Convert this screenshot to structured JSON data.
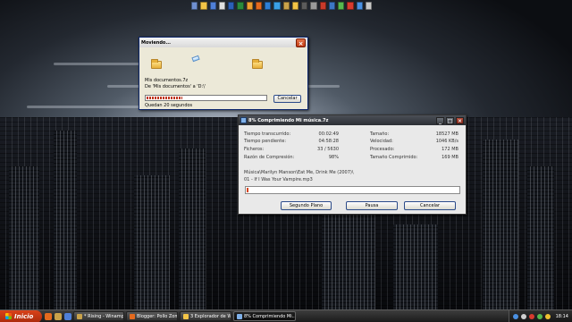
{
  "top_toolbar": {
    "icons": [
      {
        "name": "show-desktop-icon",
        "color": "#6f8fd0"
      },
      {
        "name": "folder-icon",
        "color": "#f2c447"
      },
      {
        "name": "explorer-icon",
        "color": "#4f7fd8"
      },
      {
        "name": "email-icon",
        "color": "#e0e0e0"
      },
      {
        "name": "word-icon",
        "color": "#2b5fb8"
      },
      {
        "name": "excel-icon",
        "color": "#2a8a3c"
      },
      {
        "name": "media-icon",
        "color": "#f0a030"
      },
      {
        "name": "firefox-icon",
        "color": "#e46a1e"
      },
      {
        "name": "ie-icon",
        "color": "#2d7fd6"
      },
      {
        "name": "messenger-icon",
        "color": "#3aa0e6"
      },
      {
        "name": "winamp-icon",
        "color": "#c9a24a"
      },
      {
        "name": "folder2-icon",
        "color": "#f2c447"
      },
      {
        "name": "player-icon",
        "color": "#5b5b5b"
      },
      {
        "name": "settings-icon",
        "color": "#9a9a9a"
      },
      {
        "name": "browser-icon",
        "color": "#c93a2a"
      },
      {
        "name": "network-icon",
        "color": "#3c77c6"
      },
      {
        "name": "chat-icon",
        "color": "#56b84e"
      },
      {
        "name": "security-icon",
        "color": "#d83a2e"
      },
      {
        "name": "globe-icon",
        "color": "#4a90e2"
      },
      {
        "name": "trash-icon",
        "color": "#c8c8c8"
      }
    ]
  },
  "copy_dialog": {
    "title": "Moviendo...",
    "filename": "Mis documentos.7z",
    "route": "De 'Mis documentos' a 'D:\\'",
    "remaining": "Quedan 20 segundos",
    "cancel_label": "Cancelar",
    "progress": 0.3
  },
  "zip_window": {
    "title": "8% Comprimiendo Mi música.7z",
    "left_stats": [
      {
        "label": "Tiempo transcurrido:",
        "value": "00:02:49"
      },
      {
        "label": "Tiempo pendiente:",
        "value": "04:58:28"
      },
      {
        "label": "Ficheros:",
        "value": "33 / 5630"
      },
      {
        "label": "Razón de Compresión:",
        "value": "98%"
      }
    ],
    "right_stats": [
      {
        "label": "Tamaño:",
        "value": "18527 MB"
      },
      {
        "label": "Velocidad:",
        "value": "1046 KB/s"
      },
      {
        "label": "Procesado:",
        "value": "172 MB"
      },
      {
        "label": "Tamaño Comprimido:",
        "value": "169 MB"
      }
    ],
    "path": "Música\\Marilyn Manson\\Eat Me, Drink Me (2007)\\",
    "current_file": "01 - If I Was Your Vampire.mp3",
    "progress": 0.01,
    "buttons": {
      "background": "Segundo Plano",
      "pause": "Pausa",
      "cancel": "Cancelar"
    }
  },
  "taskbar": {
    "start_label": "Inicio",
    "tasks": [
      {
        "label": "* Rising - Winamp ***",
        "icon_color": "#c9a24a",
        "active": false
      },
      {
        "label": "Blogger: Pollo Zombi...",
        "icon_color": "#e46a1e",
        "active": false
      },
      {
        "label": "3 Explorador de W...",
        "icon_color": "#f2c447",
        "active": false
      },
      {
        "label": "8% Comprimiendo Mi...",
        "icon_color": "#7fb0e8",
        "active": true
      }
    ],
    "clock": "18:14"
  }
}
